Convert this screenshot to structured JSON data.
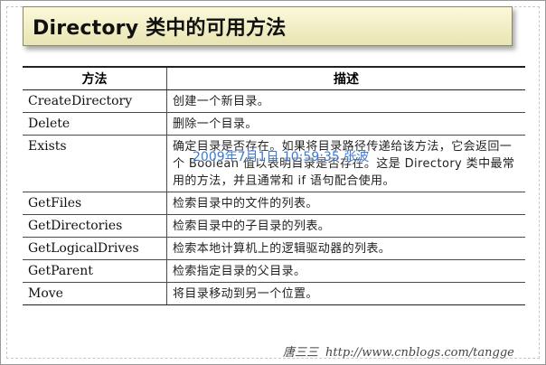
{
  "slide": {
    "title": "Directory 类中的可用方法",
    "watermark": "2009年7月1日 10:59:35 张波"
  },
  "table": {
    "headers": {
      "name": "方法",
      "description": "描述"
    },
    "rows": [
      {
        "name": "CreateDirectory",
        "description": "创建一个新目录。"
      },
      {
        "name": "Delete",
        "description": "删除一个目录。"
      },
      {
        "name": "Exists",
        "description": "确定目录是否存在。如果将目录路径传递给该方法，它会返回一个 Boolean 值以表明目录是否存在。这是 Directory 类中最常用的方法，并且通常和 if 语句配合使用。"
      },
      {
        "name": "GetFiles",
        "description": "检索目录中的文件的列表。"
      },
      {
        "name": "GetDirectories",
        "description": "检索目录中的子目录的列表。"
      },
      {
        "name": "GetLogicalDrives",
        "description": "检索本地计算机上的逻辑驱动器的列表。"
      },
      {
        "name": "GetParent",
        "description": "检索指定目录的父目录。"
      },
      {
        "name": "Move",
        "description": "将目录移动到另一个位置。"
      }
    ]
  },
  "footer": {
    "author": "唐三三",
    "url": "http://www.cnblogs.com/tangge"
  }
}
